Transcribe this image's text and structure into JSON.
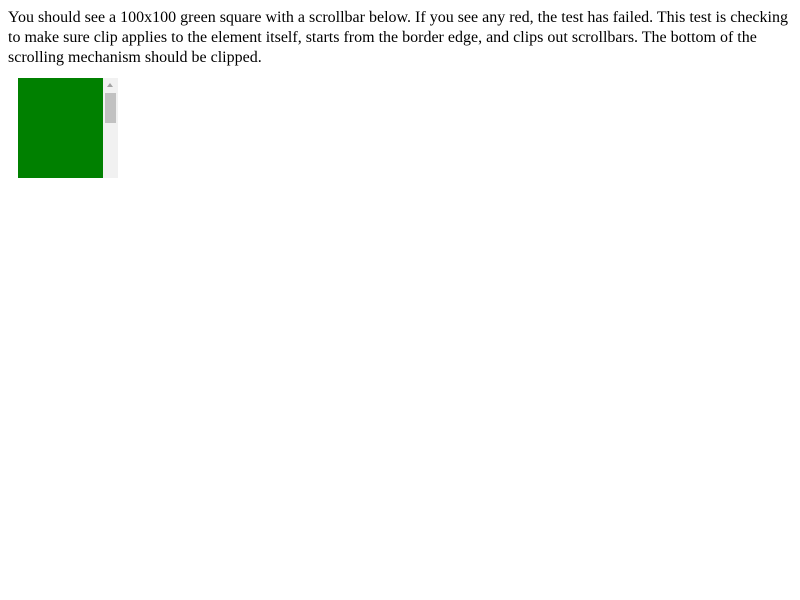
{
  "instructions": {
    "text": "You should see a 100x100 green square with a scrollbar below. If you see any red, the test has failed. This test is checking to make sure clip applies to the element itself, starts from the border edge, and clips out scrollbars. The bottom of the scrolling mechanism should be clipped."
  },
  "test_box": {
    "fill_color": "#008000",
    "scrollbar": {
      "track_color": "#f1f1f1",
      "thumb_color": "#c1c1c1",
      "arrow_icon": "chevron-up-icon"
    }
  }
}
